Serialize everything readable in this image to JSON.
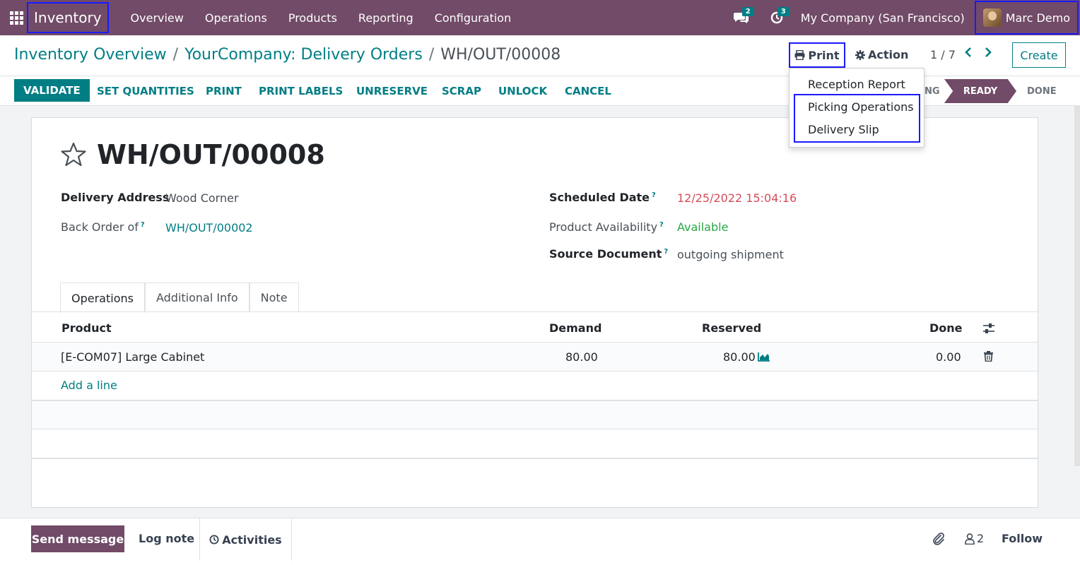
{
  "navbar": {
    "brand": "Inventory",
    "menu": [
      "Overview",
      "Operations",
      "Products",
      "Reporting",
      "Configuration"
    ],
    "messages_count": "2",
    "activities_count": "3",
    "company": "My Company (San Francisco)",
    "user": "Marc Demo"
  },
  "breadcrumb": {
    "items": [
      "Inventory Overview",
      "YourCompany: Delivery Orders"
    ],
    "current": "WH/OUT/00008",
    "separator": "/"
  },
  "toolbar": {
    "print": "Print",
    "action": "Action",
    "pager": "1 / 7",
    "create": "Create"
  },
  "print_menu": {
    "items": [
      "Reception Report",
      "Picking Operations",
      "Delivery Slip"
    ]
  },
  "statusbar": {
    "buttons": [
      "VALIDATE",
      "SET QUANTITIES",
      "PRINT",
      "PRINT LABELS",
      "UNRESERVE",
      "SCRAP",
      "UNLOCK",
      "CANCEL"
    ],
    "stages": [
      "NG",
      "READY",
      "DONE"
    ],
    "active_stage": "READY"
  },
  "record": {
    "name": "WH/OUT/00008",
    "delivery_address_label": "Delivery Address",
    "delivery_address": "Wood Corner",
    "back_order_label": "Back Order of",
    "back_order": "WH/OUT/00002",
    "scheduled_date_label": "Scheduled Date",
    "scheduled_date": "12/25/2022 15:04:16",
    "availability_label": "Product Availability",
    "availability": "Available",
    "source_label": "Source Document",
    "source": "outgoing shipment",
    "help_mark": "?"
  },
  "tabs": [
    "Operations",
    "Additional Info",
    "Note"
  ],
  "table": {
    "columns": [
      "Product",
      "Demand",
      "Reserved",
      "Done"
    ],
    "rows": [
      {
        "product": "[E-COM07] Large Cabinet",
        "demand": "80.00",
        "reserved": "80.00",
        "done": "0.00"
      }
    ],
    "add_line": "Add a line"
  },
  "chatter": {
    "send_message": "Send message",
    "log_note": "Log note",
    "activities": "Activities",
    "followers_count": "2",
    "follow": "Follow"
  },
  "colors": {
    "brand": "#714b67",
    "accent": "#017e84",
    "highlight_box": "#1a1aff",
    "date_red": "#d44c59",
    "available_green": "#28a745"
  }
}
